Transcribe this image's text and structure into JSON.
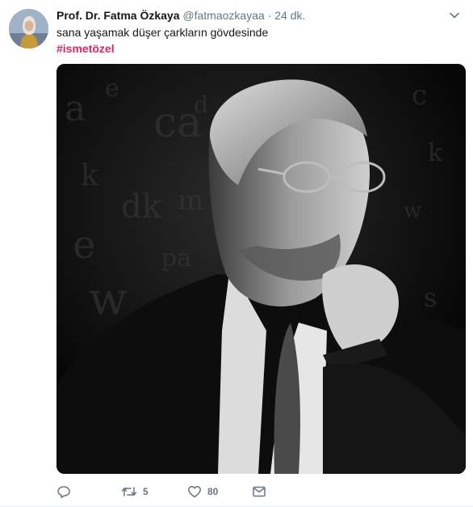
{
  "tweet": {
    "author_name": "Prof. Dr. Fatma Özkaya",
    "handle": "@fatmaozkayaa",
    "separator": "·",
    "time": "24 dk.",
    "text": "sana yaşamak düşer çarkların gövdesinde",
    "hashtag": "#ismetözel",
    "avatar": "author-avatar",
    "photo": "black-and-white portrait photo"
  },
  "actions": {
    "reply": {
      "icon": "reply-icon"
    },
    "retweet": {
      "icon": "retweet-icon",
      "count": "5"
    },
    "like": {
      "icon": "heart-icon",
      "count": "80"
    },
    "message": {
      "icon": "envelope-icon"
    }
  },
  "colors": {
    "text": "#14171a",
    "secondary": "#657786",
    "hashtag": "#e0245e"
  }
}
